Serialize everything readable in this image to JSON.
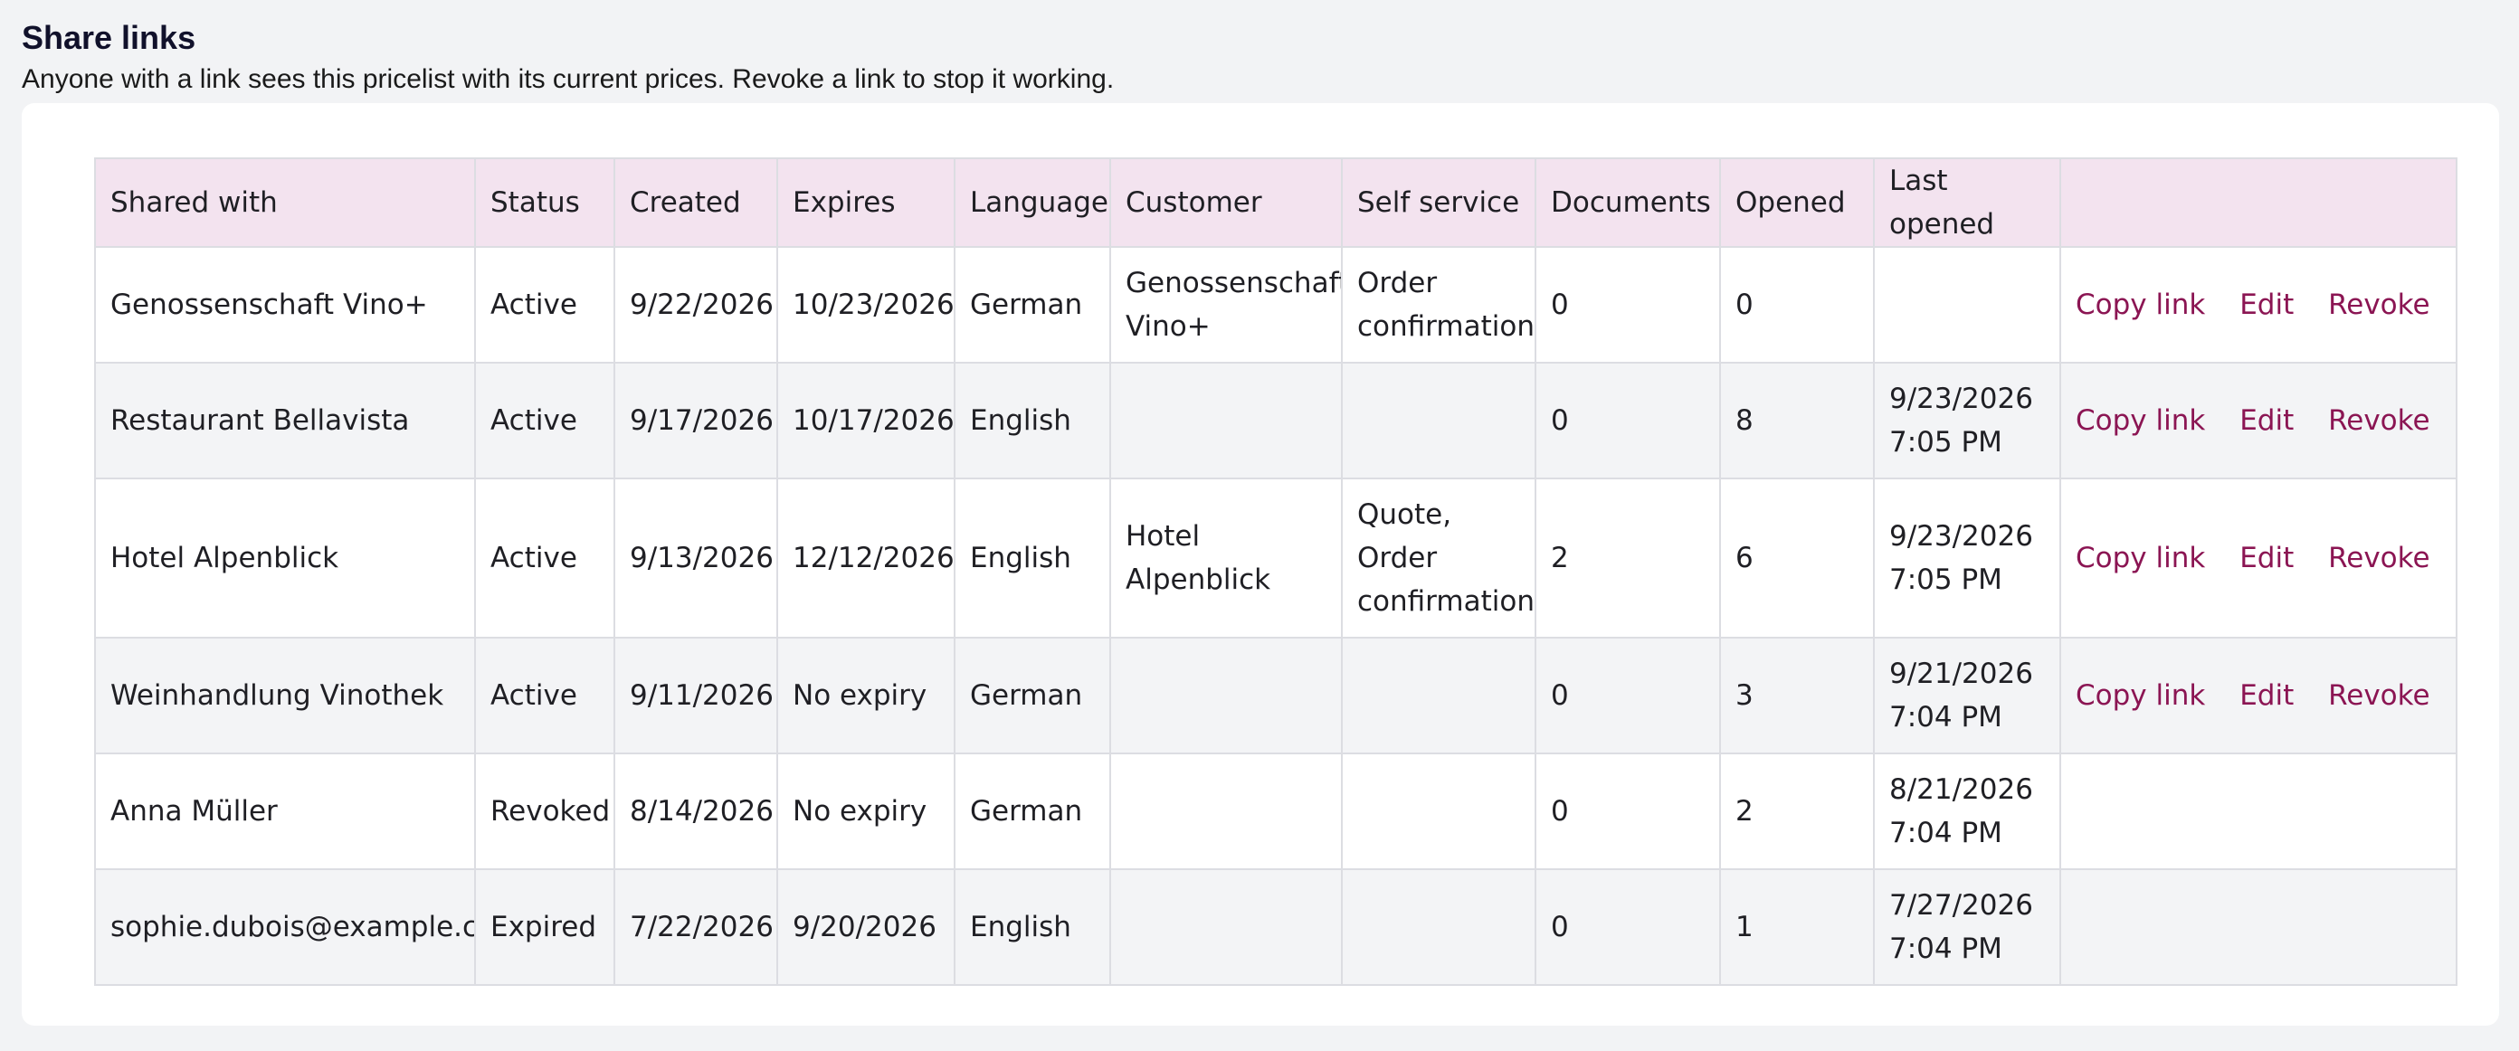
{
  "page": {
    "title": "Share links",
    "subtitle": "Anyone with a link sees this pricelist with its current prices. Revoke a link to stop it working."
  },
  "table": {
    "headers": {
      "shared_with": "Shared with",
      "status": "Status",
      "created": "Created",
      "expires": "Expires",
      "language": "Language",
      "customer": "Customer",
      "self_service": "Self service",
      "documents": "Documents",
      "opened": "Opened",
      "last_opened": "Last opened",
      "actions": ""
    },
    "actions": {
      "copy_link": "Copy link",
      "edit": "Edit",
      "revoke": "Revoke"
    },
    "rows": [
      {
        "shared_with": "Genossenschaft Vino+",
        "status": "Active",
        "created": "9/22/2026",
        "expires": "10/23/2026",
        "language": "German",
        "customer": [
          "Genossenschaft",
          "Vino+"
        ],
        "self_service": [
          "Order",
          "confirmation"
        ],
        "documents": "0",
        "opened": "0",
        "last_opened": [
          "",
          ""
        ]
      },
      {
        "shared_with": "Restaurant Bellavista",
        "status": "Active",
        "created": "9/17/2026",
        "expires": "10/17/2026",
        "language": "English",
        "customer": [
          "",
          ""
        ],
        "self_service": [
          "",
          ""
        ],
        "documents": "0",
        "opened": "8",
        "last_opened": [
          "9/23/2026",
          "7:05 PM"
        ]
      },
      {
        "shared_with": "Hotel Alpenblick",
        "status": "Active",
        "created": "9/13/2026",
        "expires": "12/12/2026",
        "language": "English",
        "customer": [
          "Hotel",
          "Alpenblick"
        ],
        "self_service": [
          "Quote,",
          "Order",
          "confirmation"
        ],
        "documents": "2",
        "opened": "6",
        "last_opened": [
          "9/23/2026",
          "7:05 PM"
        ]
      },
      {
        "shared_with": "Weinhandlung Vinothek",
        "status": "Active",
        "created": "9/11/2026",
        "expires": "No expiry",
        "language": "German",
        "customer": [
          "",
          ""
        ],
        "self_service": [
          "",
          ""
        ],
        "documents": "0",
        "opened": "3",
        "last_opened": [
          "9/21/2026",
          "7:04 PM"
        ]
      },
      {
        "shared_with": "Anna Müller",
        "status": "Revoked",
        "created": "8/14/2026",
        "expires": "No expiry",
        "language": "German",
        "customer": [
          "",
          ""
        ],
        "self_service": [
          "",
          ""
        ],
        "documents": "0",
        "opened": "2",
        "last_opened": [
          "8/21/2026",
          "7:04 PM"
        ]
      },
      {
        "shared_with": "sophie.dubois@example.ch",
        "status": "Expired",
        "created": "7/22/2026",
        "expires": "9/20/2026",
        "language": "English",
        "customer": [
          "",
          ""
        ],
        "self_service": [
          "",
          ""
        ],
        "documents": "0",
        "opened": "1",
        "last_opened": [
          "7/27/2026",
          "7:04 PM"
        ]
      }
    ]
  },
  "colors": {
    "header_bg": "#f3e3ef",
    "action_link": "#8b1553",
    "row_alt_bg": "#f3f4f6",
    "page_bg": "#f2f3f5"
  }
}
